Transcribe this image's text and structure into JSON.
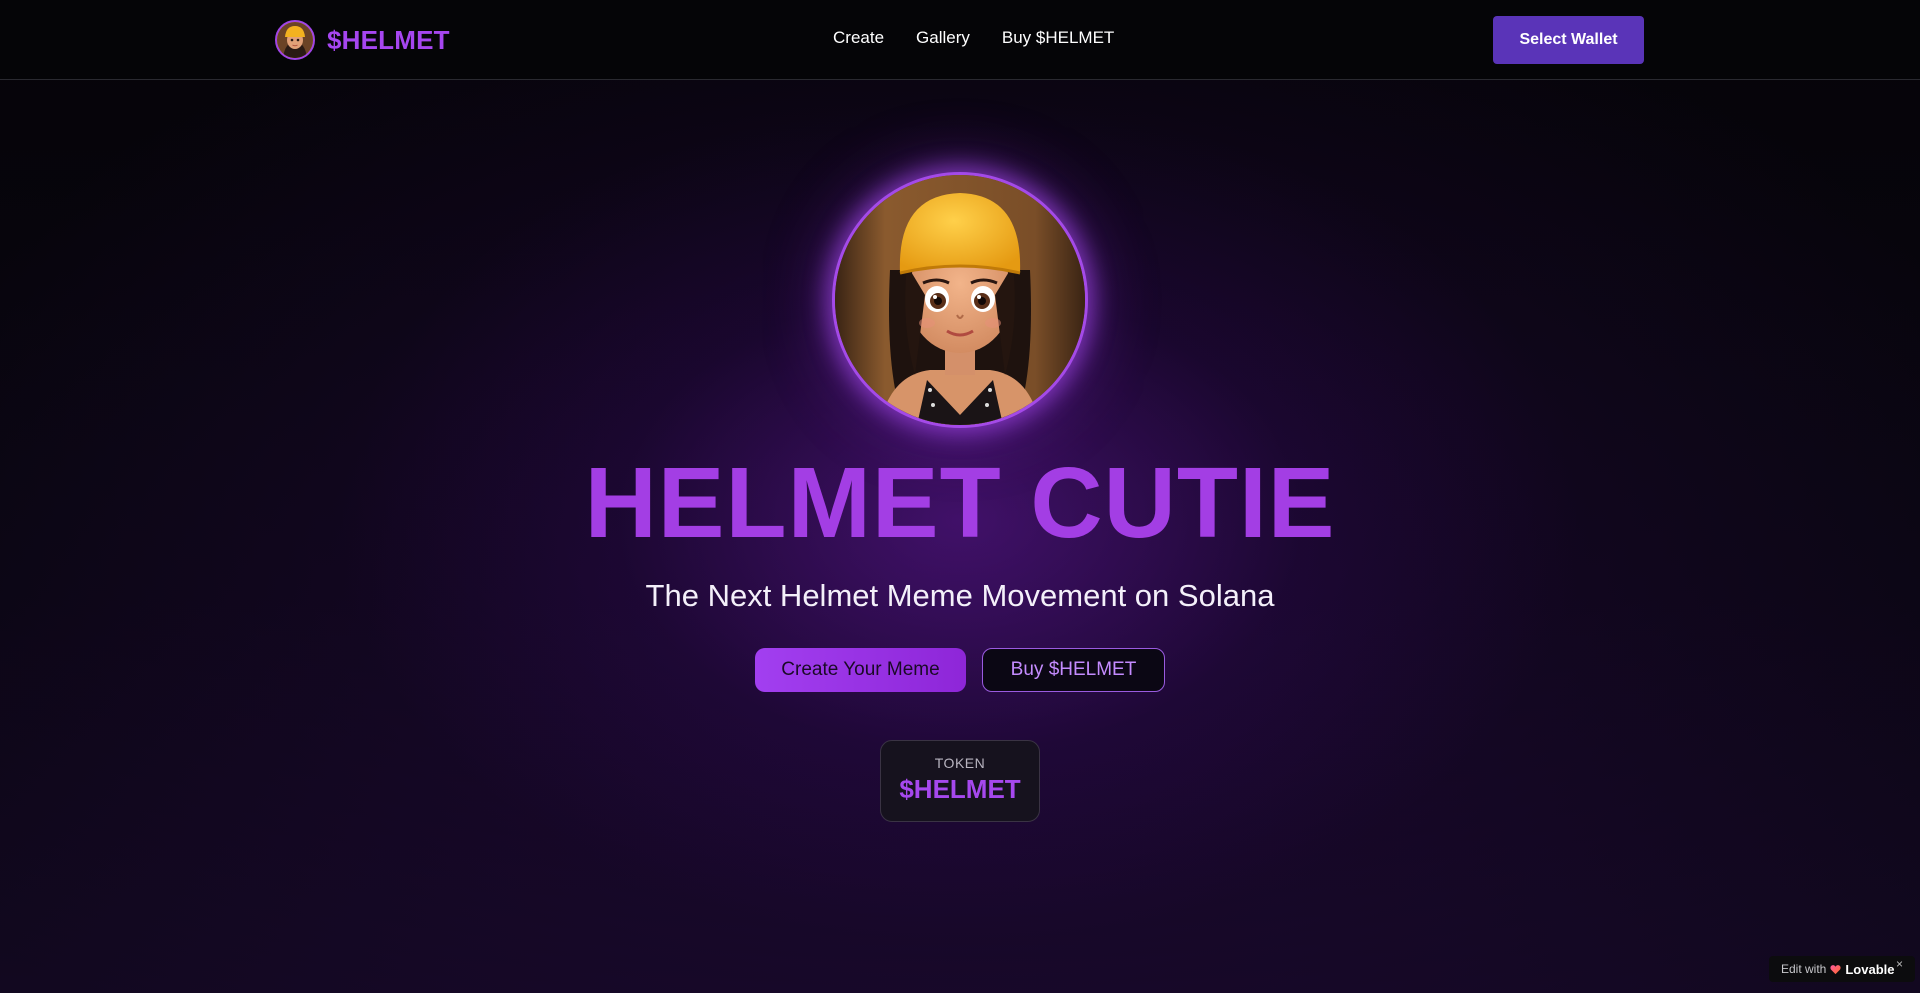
{
  "header": {
    "brand_name": "$HELMET",
    "nav": [
      "Create",
      "Gallery",
      "Buy $HELMET"
    ],
    "wallet_button": "Select Wallet"
  },
  "hero": {
    "title": "HELMET CUTIE",
    "subtitle": "The Next Helmet Meme Movement on Solana",
    "primary_button": "Create Your Meme",
    "secondary_button": "Buy $HELMET"
  },
  "token": {
    "label": "TOKEN",
    "value": "$HELMET"
  },
  "badge": {
    "prefix": "Edit with",
    "brand": "Lovable",
    "close": "×"
  },
  "colors": {
    "accent": "#a33ee4",
    "wallet": "#5a34b8",
    "background": "#05040a"
  },
  "icons": [
    "helmet-girl-avatar",
    "lovable-heart-icon",
    "close-icon"
  ]
}
